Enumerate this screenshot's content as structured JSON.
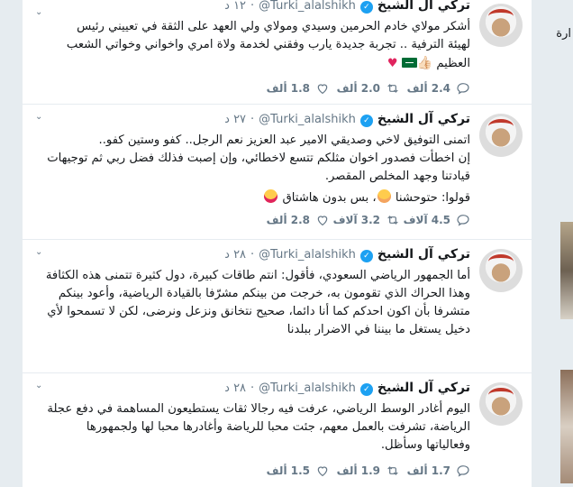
{
  "sidebar_right": {
    "partial_text": "ارة"
  },
  "tweets": [
    {
      "name": "تركي آل الشيخ",
      "handle": "@Turki_alalshikh",
      "time": "١٢ د",
      "lines": [
        "أشكر مولاي خادم الحرمين وسيدي ومولاي ولي العهد على الثقة في تعييني رئيس",
        "لهيئة الترفية .. تجربة جديدة يارب وفقني لخدمة ولاة امري واخواني وخواتي الشعب",
        "العظيم"
      ],
      "emoji_suffix": [
        "heart-icon",
        "flag-icon",
        "thumbs-up-icon"
      ],
      "replies": "2.4 ألف",
      "retweets": "2.0 ألف",
      "likes": "1.8 ألف"
    },
    {
      "name": "تركي آل الشيخ",
      "handle": "@Turki_alalshikh",
      "time": "٢٧ د",
      "lines": [
        "اتمنى التوفيق لاخي وصديقي الامير عبد العزيز نعم الرجل.. كفو وستين كفو..",
        "إن اخطأت فصدور اخوان مثلكم تتسع لاخطائي، وإن إصبت فذلك فضل ربي ثم توجيهات",
        "قيادتنا وجهد المخلص المقصر."
      ],
      "quote_line": "قولوا: حتوحشنا",
      "quote_tail": "، بس بدون هاشتاق",
      "replies": "4.5 آلاف",
      "retweets": "3.2 آلاف",
      "likes": "2.8 ألف"
    },
    {
      "name": "تركي آل الشيخ",
      "handle": "@Turki_alalshikh",
      "time": "٢٨ د",
      "lines": [
        "أما الجمهور الرياضي السعودي، فأقول: انتم طاقات كبيرة، دول كثيرة تتمنى هذه الكثافة",
        "وهذا الحراك الذي تقومون به، خرجت من بينكم مشرّفا بالقيادة الرياضية، وأعود بينكم",
        "متشرفا بأن اكون احدكم كما أنا دائما، صحيح نتخانق ونزعل ونرضى، لكن لا تسمحوا لأي",
        "دخيل يستغل ما بيننا في الاضرار ببلدنا"
      ]
    },
    {
      "name": "تركي آل الشيخ",
      "handle": "@Turki_alalshikh",
      "time": "٢٨ د",
      "lines": [
        "اليوم أغادر الوسط الرياضي، عرفت فيه رجالا ثقات يستطيعون المساهمة في دفع عجلة",
        "الرياضة، تشرفت بالعمل معهم، جئت محبا للرياضة وأغادرها محبا لها ولجمهورها",
        "وفعالياتها وسأظل."
      ],
      "replies": "",
      "retweets": "1.9 ألف",
      "likes": "1.5 ألف",
      "likes_count_first": "1.7 ألف"
    }
  ]
}
